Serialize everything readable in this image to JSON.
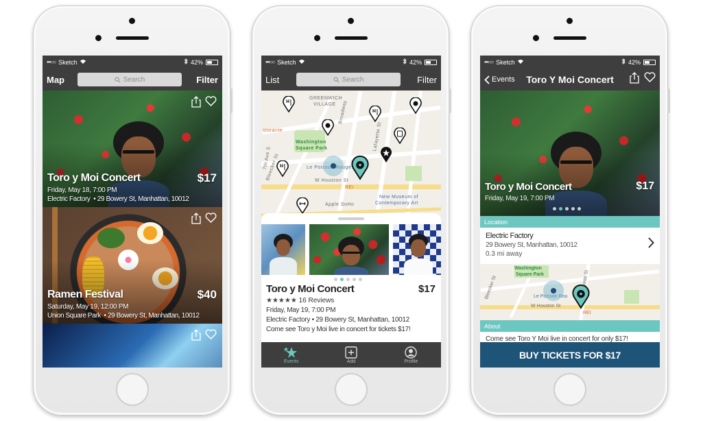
{
  "colors": {
    "teal": "#6cc7c0",
    "navy": "#1e5478",
    "bar": "#3e3e3e"
  },
  "status": {
    "signal": "•••○○",
    "carrier": "Sketch",
    "battery": "42%"
  },
  "list_screen": {
    "nav_left": "Map",
    "nav_right": "Filter",
    "search_placeholder": "Search",
    "events": [
      {
        "title": "Toro y Moi Concert",
        "date": "Friday, May 18, 7:00 PM",
        "venue": "Electric Factory",
        "address": "• 29 Bowery St, Manhattan, 10012",
        "price": "$17"
      },
      {
        "title": "Ramen Festival",
        "date": "Saturday, May 19, 12:00 PM",
        "venue": "Union Square Park",
        "address": "• 29 Bowery St, Manhattan, 10012",
        "price": "$40"
      }
    ]
  },
  "map_screen": {
    "nav_left": "List",
    "nav_right": "Filter",
    "search_placeholder": "Search",
    "map_labels": {
      "greenwich": "GREENWICH",
      "village": "VILLAGE",
      "washington": "Washington",
      "square_park": "Square Park",
      "broadway": "Broadway",
      "lafayette": "Lafayette St",
      "storante": "storante",
      "le_poisson": "Le Poisson Rouge",
      "w_houston": "W Houston St",
      "rei": "REI",
      "apple": "Apple SoHo",
      "museum1": "New Museum of",
      "museum2": "Contemporary Art",
      "bleecker": "Bleecker St",
      "seventh": "7th Ave S"
    },
    "card": {
      "title": "Toro y Moi Concert",
      "price": "$17",
      "stars": "★★★★★",
      "reviews": "16 Reviews",
      "date": "Friday, May 19, 7:00 PM",
      "location": "Electric Factory • 29 Bowery St, Manhattan, 10012",
      "description": "Come see Toro y Moi live in concert for tickets $17!"
    },
    "tabs": [
      {
        "label": "Events"
      },
      {
        "label": "Add"
      },
      {
        "label": "Profile"
      }
    ]
  },
  "detail_screen": {
    "back": "Events",
    "title": "Toro Y Moi Concert",
    "hero_title": "Toro y Moi Concert",
    "hero_date": "Friday, May 19, 7:00 PM",
    "hero_price": "$17",
    "location_header": "Location",
    "venue": "Electric Factory",
    "address": "29 Bowery St, Manhattan, 10012",
    "distance": "0.3 mi away",
    "map_labels": {
      "washington": "Washington",
      "square_park": "Square Park",
      "bleecker": "Bleecker St",
      "lafayette": "Lafayette St",
      "le_poisson": "Le Poisson Rou",
      "w_houston": "W Houston St",
      "rei": "REI"
    },
    "about_header": "About",
    "about_text": "Come see Toro Y Moi live in concert for only $17!",
    "buy_label": "BUY TICKETS FOR $17"
  }
}
